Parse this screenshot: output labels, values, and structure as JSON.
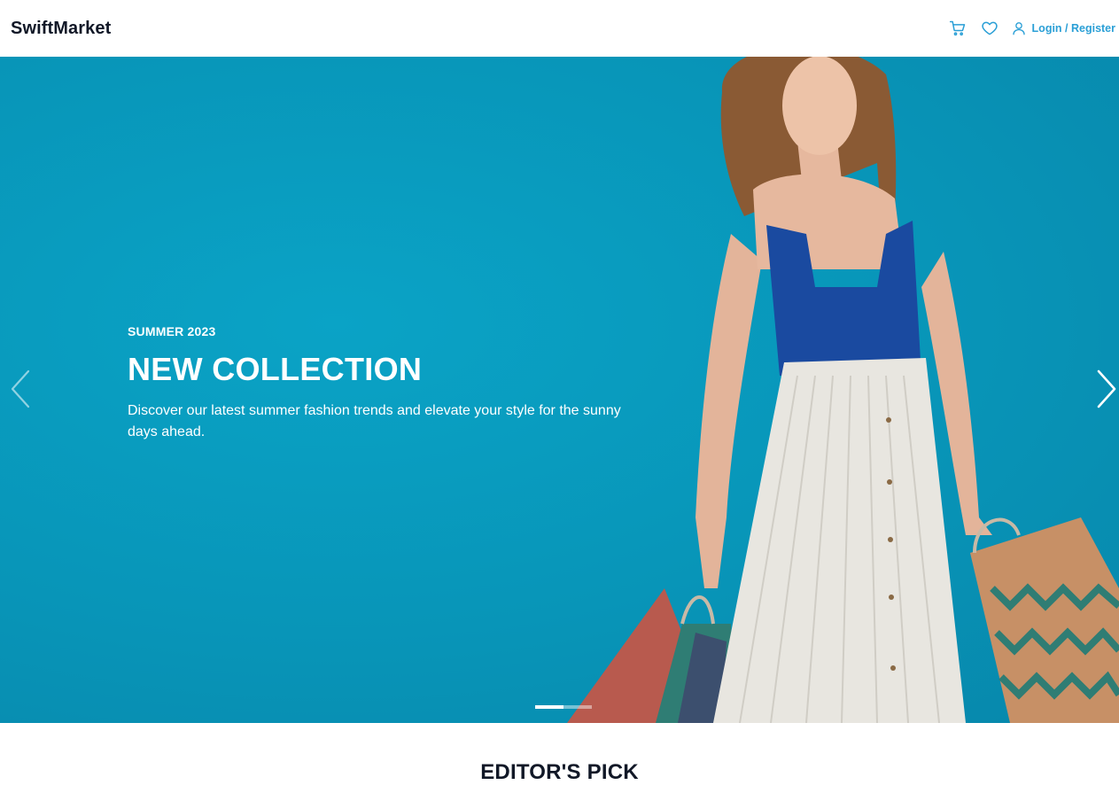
{
  "header": {
    "brand": "SwiftMarket",
    "cart_icon": "cart-icon",
    "wishlist_icon": "heart-icon",
    "user_icon": "user-icon",
    "login_label": "Login / Register",
    "accent_color": "#2a9fd6"
  },
  "hero": {
    "eyebrow": "SUMMER 2023",
    "title": "NEW COLLECTION",
    "description": "Discover our latest summer fashion trends and elevate your style for the sunny days ahead.",
    "background_color": "#0898bb",
    "prev_icon": "chevron-left-icon",
    "next_icon": "chevron-right-icon",
    "slides_total": 2,
    "active_slide": 1
  },
  "editors_pick": {
    "title": "EDITOR'S PICK"
  }
}
